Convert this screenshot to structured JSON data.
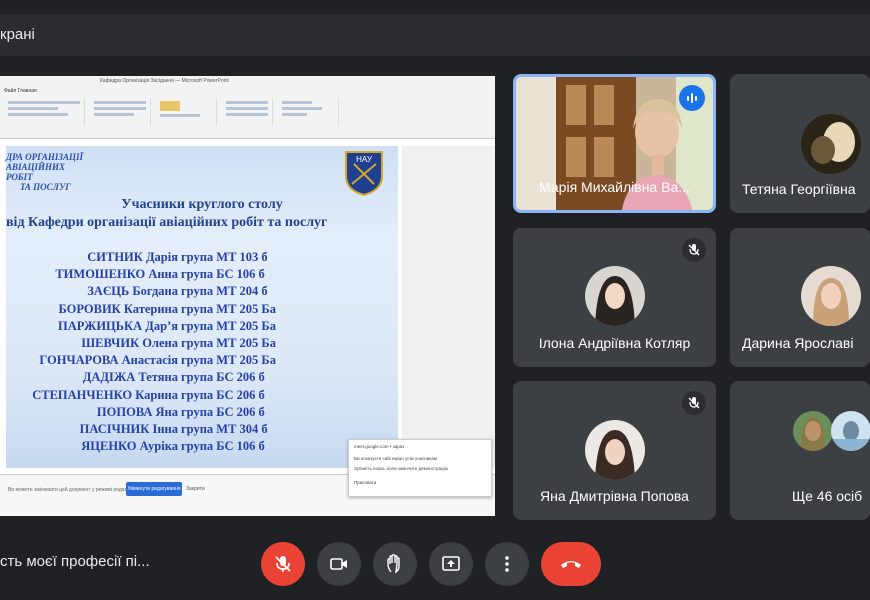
{
  "topbar": {
    "title": "крані"
  },
  "presentation": {
    "ribbon_title": "Кафедра Організація Засідання — Microsoft PowerPoint",
    "ribbon_tab": "Файл  Главная",
    "department_lines": [
      "ДРА ОРГАНІЗАЦІЇ",
      "АВІАЦІЙНИХ РОБІТ",
      "ТА ПОСЛУГ"
    ],
    "logo_text": "НАУ",
    "heading1": "Учасники круглого столу",
    "heading2": "від Кафедри організації авіаційних робіт та послуг",
    "participants": [
      {
        "name": "СИТНИК Дарія",
        "group": "група МТ 103 б"
      },
      {
        "name": "ТИМОШЕНКО Анна",
        "group": "група БС 106 б"
      },
      {
        "name": "ЗАЄЦЬ Богдана",
        "group": "група МТ 204 б"
      },
      {
        "name": "БОРОВИК Катерина",
        "group": "група МТ 205 Ба"
      },
      {
        "name": "ПАРЖИЦЬКА Дар’я",
        "group": "група МТ 205 Ба"
      },
      {
        "name": "ШЕВЧИК Олена",
        "group": "група МТ 205 Ба"
      },
      {
        "name": "ГОНЧАРОВА Анастасія",
        "group": "група МТ 205 Ба"
      },
      {
        "name": "ДАДІЖА Тетяна",
        "group": "група БС 206 б"
      },
      {
        "name": "СТЕПАНЧЕНКО Карина",
        "group": "група БС 206 б"
      },
      {
        "name": "ПОПОВА Яна",
        "group": "група БС 206 б"
      },
      {
        "name": "ПАСІЧНИК Інна",
        "group": "група МТ 304 б"
      },
      {
        "name": "ЯЦЕНКО Ауріка",
        "group": "група БС 106 б"
      }
    ],
    "status_msg": "Ви можете змінювати цей документ у режимі редагування",
    "status_button": "Увімкнути редагування",
    "status_button2": "Закрити",
    "notif_lines": [
      "meet.google.com • зараз",
      "Ви показуєте свій екран усім учасникам",
      "Зупиніть показ, коли закінчите демонстрацію",
      "Приховати"
    ]
  },
  "participants": [
    {
      "name": "Марія Михайлівна Ва...",
      "type": "video",
      "speaking": true
    },
    {
      "name": "Тетяна Георгіївна",
      "type": "avatar"
    },
    {
      "name": "Ілона Андріївна Котляр",
      "type": "avatar",
      "muted": true
    },
    {
      "name": "Дарина Ярославі",
      "type": "avatar"
    },
    {
      "name": "Яна Дмитрівна Попова",
      "type": "avatar",
      "muted": true
    },
    {
      "name": "Ще 46 осіб",
      "type": "group"
    }
  ],
  "controls": {
    "meeting_title": "сть моєї професії пі...",
    "mic_icon": "mic-off-icon",
    "camera_icon": "videocam-icon",
    "hand_icon": "raise-hand-icon",
    "present_icon": "present-screen-icon",
    "more_icon": "more-vert-icon",
    "end_icon": "call-end-icon"
  },
  "colors": {
    "background": "#202124",
    "tile": "#3c4043",
    "accent": "#8ab4f8",
    "red": "#ea4335",
    "slide_text": "#2442a8"
  }
}
